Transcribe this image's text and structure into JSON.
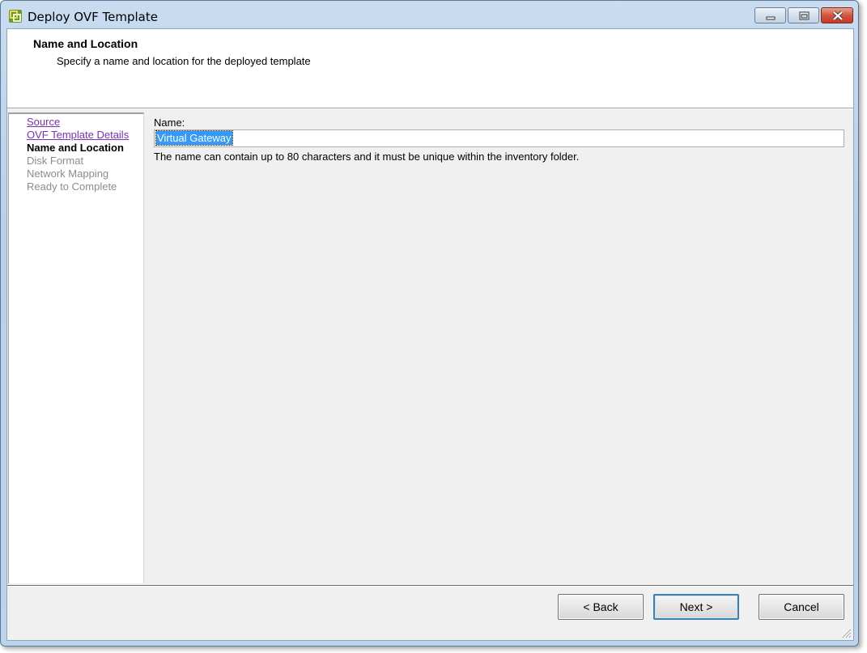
{
  "window": {
    "title": "Deploy OVF Template"
  },
  "header": {
    "title": "Name and Location",
    "subtitle": "Specify a name and location for the deployed template"
  },
  "steps": [
    {
      "label": "Source",
      "state": "completed"
    },
    {
      "label": "OVF Template Details",
      "state": "completed"
    },
    {
      "label": "Name and Location",
      "state": "current"
    },
    {
      "label": "Disk Format",
      "state": "pending"
    },
    {
      "label": "Network Mapping",
      "state": "pending"
    },
    {
      "label": "Ready to Complete",
      "state": "pending"
    }
  ],
  "form": {
    "name_label": "Name:",
    "name_value": "Virtual Gateway",
    "help_text": "The name can contain up to 80 characters and it must be unique within the inventory folder."
  },
  "buttons": {
    "back": "< Back",
    "next": "Next >",
    "cancel": "Cancel"
  },
  "colors": {
    "completed_link": "#7b2fbe",
    "pending_text": "#8c8c8c",
    "selection": "#3399ff"
  },
  "icons": {
    "app": "vsphere-app-icon",
    "minimize": "minimize-icon",
    "maximize": "maximize-icon",
    "close": "close-icon",
    "resize": "resize-grip-icon"
  }
}
